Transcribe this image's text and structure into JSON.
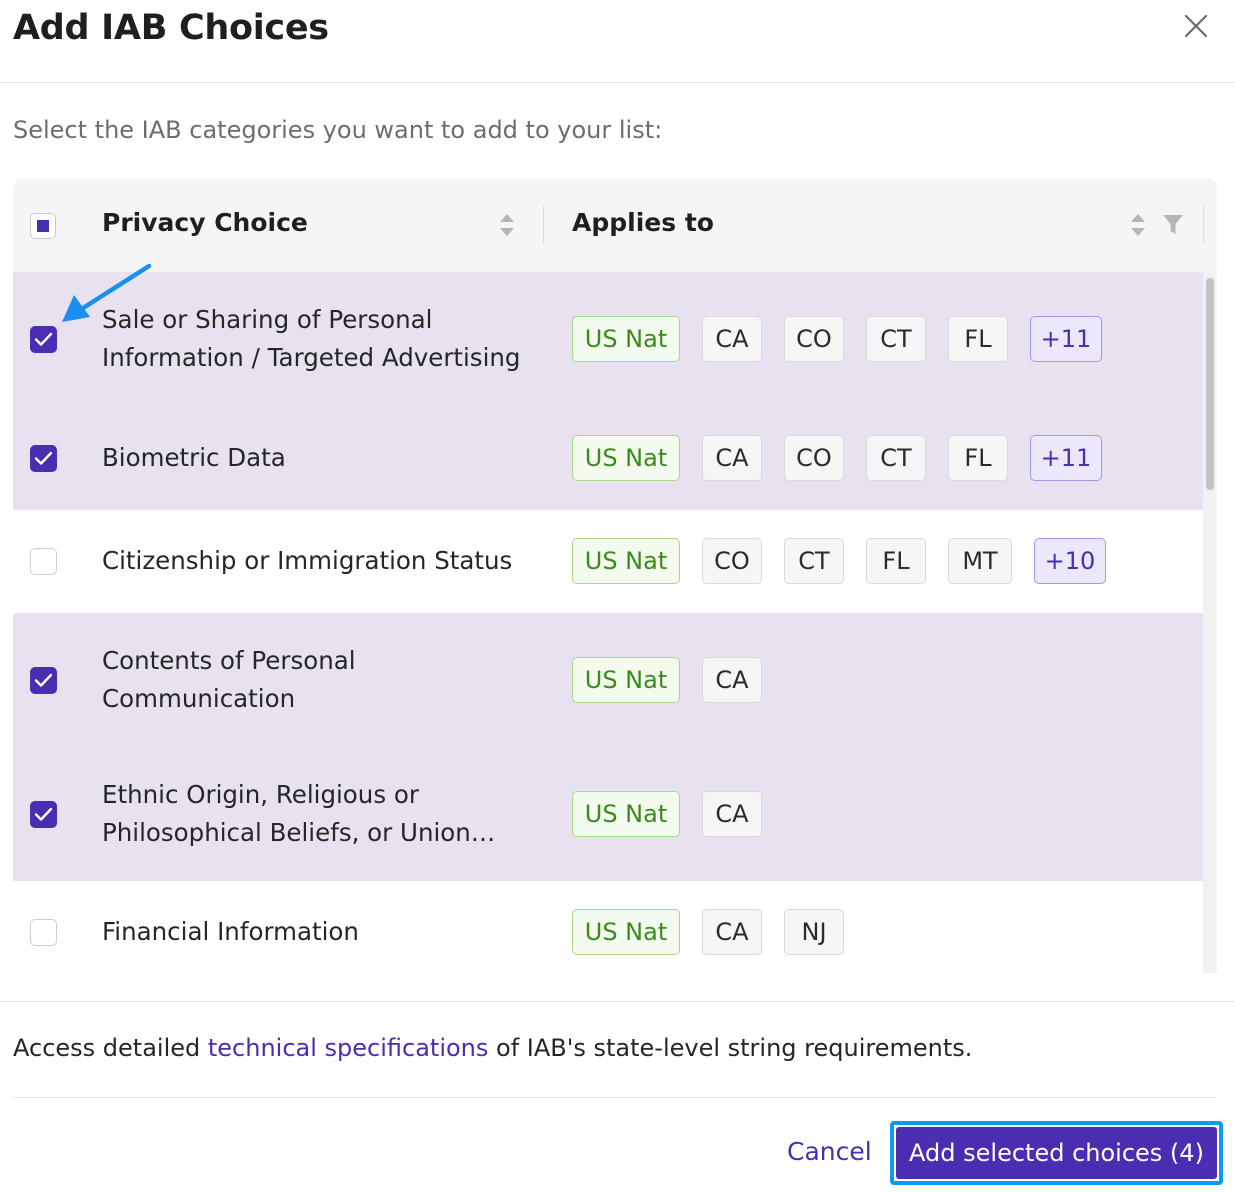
{
  "dialog": {
    "title": "Add IAB Choices",
    "instructions": "Select the IAB categories you want to add to your list:",
    "close_icon": "close-icon"
  },
  "table": {
    "columns": {
      "privacy_choice": "Privacy Choice",
      "applies_to": "Applies to"
    },
    "select_all_state": "partial",
    "rows": [
      {
        "name_lines": [
          "Sale or Sharing of Personal",
          "Information / Targeted Advertising"
        ],
        "checked": true,
        "tags": [
          "US Nat",
          "CA",
          "CO",
          "CT",
          "FL"
        ],
        "more": "+11"
      },
      {
        "name_lines": [
          "Biometric Data"
        ],
        "checked": true,
        "tags": [
          "US Nat",
          "CA",
          "CO",
          "CT",
          "FL"
        ],
        "more": "+11"
      },
      {
        "name_lines": [
          "Citizenship or Immigration Status"
        ],
        "checked": false,
        "tags": [
          "US Nat",
          "CO",
          "CT",
          "FL",
          "MT"
        ],
        "more": "+10"
      },
      {
        "name_lines": [
          "Contents of Personal",
          "Communication"
        ],
        "checked": true,
        "tags": [
          "US Nat",
          "CA"
        ],
        "more": ""
      },
      {
        "name_lines": [
          "Ethnic Origin, Religious or",
          "Philosophical Beliefs, or Union…"
        ],
        "checked": true,
        "tags": [
          "US Nat",
          "CA"
        ],
        "more": ""
      },
      {
        "name_lines": [
          "Financial Information"
        ],
        "checked": false,
        "tags": [
          "US Nat",
          "CA",
          "NJ"
        ],
        "more": ""
      }
    ]
  },
  "footnote": {
    "prefix": "Access detailed ",
    "link": "technical specifications",
    "suffix": " of IAB's state-level string requirements."
  },
  "actions": {
    "cancel": "Cancel",
    "primary": "Add selected choices (4)"
  },
  "colors": {
    "accent": "#4a2db0",
    "selected_row": "#e8e1f0",
    "tag_green": "#3b8a1d",
    "focus_ring": "#0a9cf5",
    "annotation_arrow": "#1a8ff0"
  }
}
